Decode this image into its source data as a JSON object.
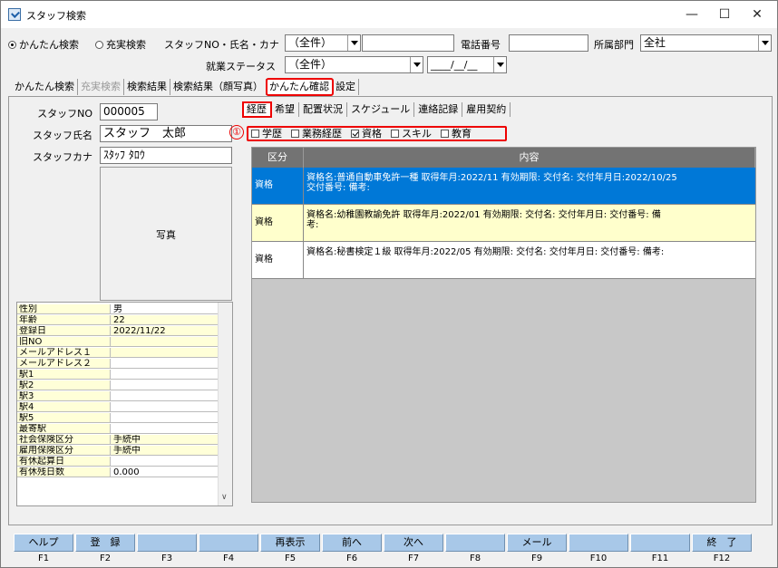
{
  "window": {
    "title": "スタッフ検索",
    "minimize": "—",
    "maximize": "☐",
    "close": "✕"
  },
  "search": {
    "mode_simple": "かんたん検索",
    "mode_full": "充実検索",
    "staff_label": "スタッフNO・氏名・カナ",
    "staff_select": "（全件）",
    "phone_label": "電話番号",
    "dept_label": "所属部門",
    "dept_value": "全社",
    "status_label": "就業ステータス",
    "status_select": "（全件）",
    "date_value": "____/__/__"
  },
  "main_tabs": [
    "かんたん検索",
    "充実検索",
    "検索結果",
    "検索結果（顔写真）",
    "かんたん確認",
    "設定"
  ],
  "staff": {
    "no_label": "スタッフNO",
    "no_value": "000005",
    "name_label": "スタッフ氏名",
    "name_value": "スタッフ　太郎",
    "kana_label": "スタッフカナ",
    "kana_value": "ｽﾀｯﾌ ﾀﾛｳ",
    "photo_label": "写真"
  },
  "details": [
    {
      "k": "性別",
      "v": "男"
    },
    {
      "k": "年齢",
      "v": "22"
    },
    {
      "k": "登録日",
      "v": "2022/11/22"
    },
    {
      "k": "旧NO",
      "v": ""
    },
    {
      "k": "メールアドレス１",
      "v": ""
    },
    {
      "k": "メールアドレス２",
      "v": ""
    },
    {
      "k": "駅1",
      "v": ""
    },
    {
      "k": "駅2",
      "v": ""
    },
    {
      "k": "駅3",
      "v": ""
    },
    {
      "k": "駅4",
      "v": ""
    },
    {
      "k": "駅5",
      "v": ""
    },
    {
      "k": "最寄駅",
      "v": ""
    },
    {
      "k": "社会保険区分",
      "v": "手続中"
    },
    {
      "k": "雇用保険区分",
      "v": "手続中"
    },
    {
      "k": "有休起算日",
      "v": ""
    },
    {
      "k": "有休残日数",
      "v": "0.000"
    }
  ],
  "sub_tabs": [
    "経歴",
    "希望",
    "配置状況",
    "スケジュール",
    "連絡記録",
    "雇用契約"
  ],
  "annotation": "①",
  "filters": [
    {
      "label": "学歴",
      "checked": false
    },
    {
      "label": "業務経歴",
      "checked": false
    },
    {
      "label": "資格",
      "checked": true
    },
    {
      "label": "スキル",
      "checked": false
    },
    {
      "label": "教育",
      "checked": false
    }
  ],
  "table": {
    "headers": [
      "区分",
      "内容"
    ],
    "rows": [
      {
        "c1": "資格",
        "c2a": "資格名:普通自動車免許一種 取得年月:2022/11 有効期限: 交付名: 交付年月日:2022/10/25",
        "c2b": "交付番号: 備考:"
      },
      {
        "c1": "資格",
        "c2a": "資格名:幼稚園教諭免許 取得年月:2022/01 有効期限: 交付名: 交付年月日: 交付番号: 備",
        "c2b": "考:"
      },
      {
        "c1": "資格",
        "c2a": "資格名:秘書検定１級 取得年月:2022/05 有効期限: 交付名: 交付年月日: 交付番号: 備考:",
        "c2b": ""
      }
    ]
  },
  "fkeys": [
    {
      "label": "ヘルプ",
      "key": "F1"
    },
    {
      "label": "登　録",
      "key": "F2"
    },
    {
      "label": "",
      "key": "F3"
    },
    {
      "label": "",
      "key": "F4"
    },
    {
      "label": "再表示",
      "key": "F5"
    },
    {
      "label": "前へ",
      "key": "F6"
    },
    {
      "label": "次へ",
      "key": "F7"
    },
    {
      "label": "",
      "key": "F8"
    },
    {
      "label": "メール",
      "key": "F9"
    },
    {
      "label": "",
      "key": "F10"
    },
    {
      "label": "",
      "key": "F11"
    },
    {
      "label": "終　了",
      "key": "F12"
    }
  ]
}
